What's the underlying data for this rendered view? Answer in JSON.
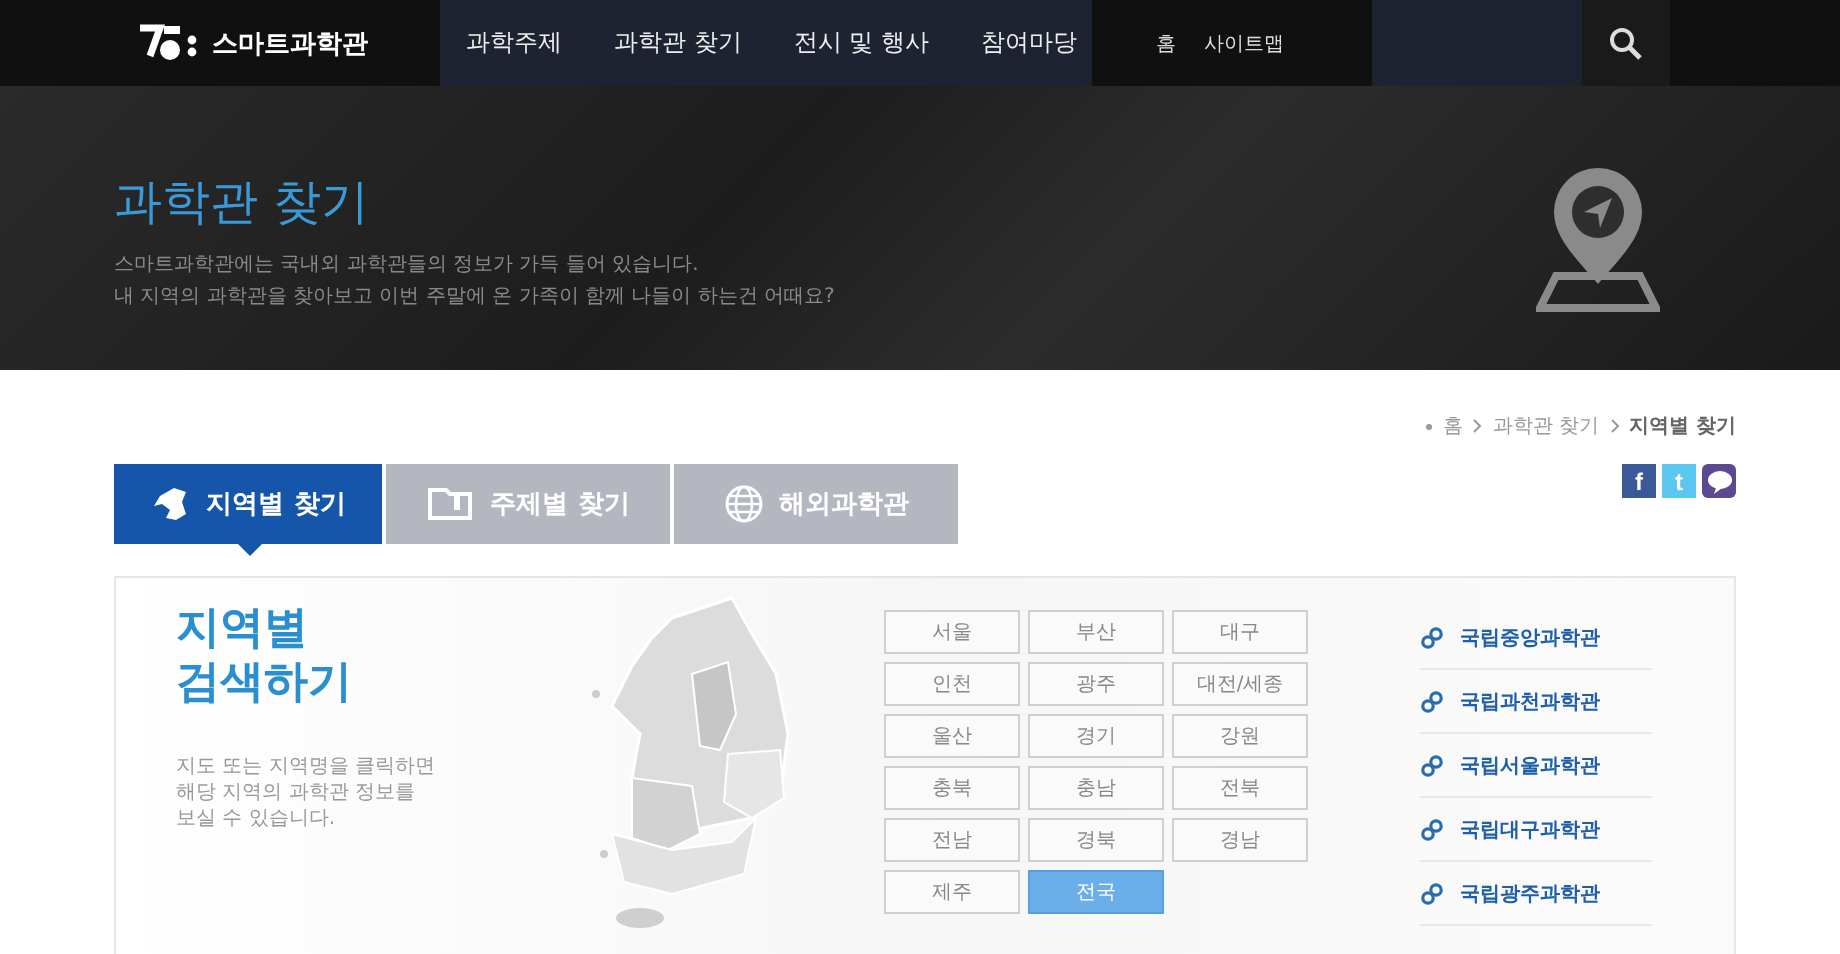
{
  "header": {
    "logo_text": "스마트과학관",
    "menu": [
      {
        "label": "과학주제",
        "selected": false
      },
      {
        "label": "과학관 찾기",
        "selected": false
      },
      {
        "label": "전시 및 행사",
        "selected": false
      },
      {
        "label": "참여마당",
        "selected": false
      }
    ],
    "utility_links": [
      "홈",
      "사이트맵"
    ]
  },
  "banner": {
    "title": "과학관 찾기",
    "lines": [
      "스마트과학관에는 국내외 과학관들의 정보가 가득 들어 있습니다.",
      "내 지역의 과학관을 찾아보고 이번 주말에 온 가족이 함께 나들이 하는건 어때요?"
    ]
  },
  "breadcrumb": [
    "홈",
    "과학관 찾기",
    "지역별 찾기"
  ],
  "social": [
    {
      "kind": "facebook",
      "label": "f"
    },
    {
      "kind": "twitter",
      "label": "t"
    },
    {
      "kind": "talk"
    }
  ],
  "tabs": [
    {
      "kind": "region",
      "label": "지역별 찾기",
      "selected": true
    },
    {
      "kind": "theme",
      "label": "주제별 찾기",
      "selected": false
    },
    {
      "kind": "overseas",
      "label": "해외과학관",
      "selected": false
    }
  ],
  "panel": {
    "title_lines": [
      "지역별",
      "검색하기"
    ],
    "description_lines": [
      "지도 또는 지역명을 클릭하면",
      "해당 지역의 과학관 정보를",
      "보실 수 있습니다."
    ],
    "regions": [
      {
        "label": "서울",
        "selected": false
      },
      {
        "label": "부산",
        "selected": false
      },
      {
        "label": "대구",
        "selected": false
      },
      {
        "label": "인천",
        "selected": false
      },
      {
        "label": "광주",
        "selected": false
      },
      {
        "label": "대전/세종",
        "selected": false
      },
      {
        "label": "울산",
        "selected": false
      },
      {
        "label": "경기",
        "selected": false
      },
      {
        "label": "강원",
        "selected": false
      },
      {
        "label": "충북",
        "selected": false
      },
      {
        "label": "충남",
        "selected": false
      },
      {
        "label": "전북",
        "selected": false
      },
      {
        "label": "전남",
        "selected": false
      },
      {
        "label": "경북",
        "selected": false
      },
      {
        "label": "경남",
        "selected": false
      },
      {
        "label": "제주",
        "selected": false
      },
      {
        "label": "전국",
        "selected": true
      }
    ],
    "museums": [
      "국립중앙과학관",
      "국립과천과학관",
      "국립서울과학관",
      "국립대구과학관",
      "국립광주과학관"
    ]
  }
}
